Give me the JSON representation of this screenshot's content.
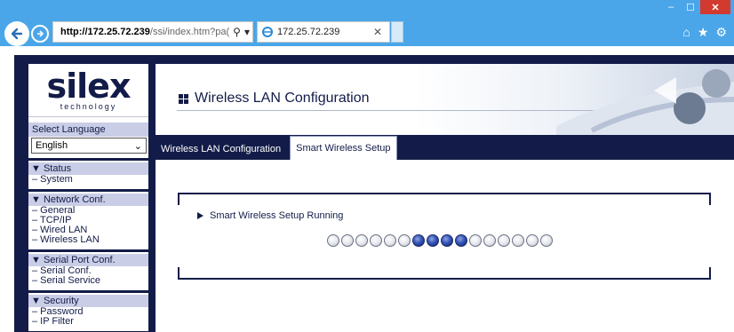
{
  "browser": {
    "url_host": "http://172.25.72.239",
    "url_rest": "/ssi/index.htm?pa(",
    "tab_title": "172.25.72.239",
    "win_minimize": "–",
    "win_maximize": "☐",
    "win_close": "✕"
  },
  "sidebar": {
    "logo_brand": "silex",
    "logo_tagline": "technology",
    "select_language_label": "Select Language",
    "language_value": "English",
    "groups": [
      {
        "title": "▼ Status",
        "items": [
          "– System"
        ]
      },
      {
        "title": "▼ Network Conf.",
        "items": [
          "– General",
          "– TCP/IP",
          "– Wired LAN",
          "– Wireless LAN"
        ]
      },
      {
        "title": "▼ Serial Port Conf.",
        "items": [
          "– Serial Conf.",
          "– Serial Service"
        ]
      },
      {
        "title": "▼ Security",
        "items": [
          "– Password",
          "– IP Filter"
        ]
      }
    ]
  },
  "main": {
    "page_title": "Wireless LAN Configuration",
    "tabs": [
      {
        "label": "Wireless LAN Configuration",
        "active": false
      },
      {
        "label": "Smart Wireless Setup",
        "active": true
      }
    ],
    "status_text": "Smart Wireless Setup Running",
    "progress": {
      "total": 16,
      "active_indices": [
        6,
        7,
        8,
        9
      ]
    }
  },
  "colors": {
    "brand_navy": "#131c48",
    "chrome_blue": "#4aa6e8",
    "nav_highlight": "#c9cde6",
    "active_dot": "#3556b8"
  }
}
